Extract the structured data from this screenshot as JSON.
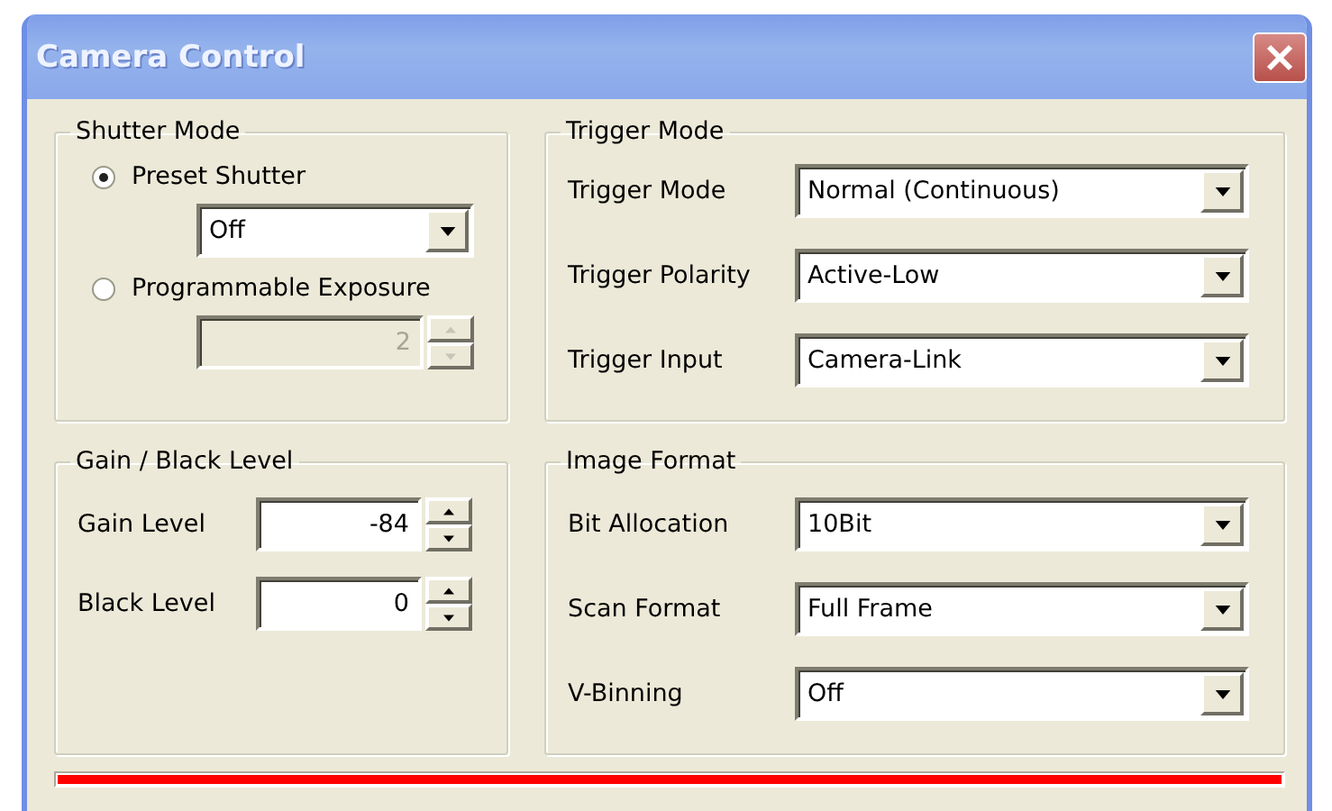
{
  "window": {
    "title": "Camera Control"
  },
  "shutter_mode": {
    "title": "Shutter Mode",
    "options": [
      {
        "label": "Preset Shutter",
        "selected": true,
        "kind": "dropdown",
        "value": "Off",
        "disabled": false
      },
      {
        "label": "Programmable Exposure",
        "selected": false,
        "kind": "spinner",
        "value": "2",
        "disabled": true
      }
    ]
  },
  "trigger_mode": {
    "title": "Trigger Mode",
    "fields": [
      {
        "label": "Trigger Mode",
        "value": "Normal (Continuous)"
      },
      {
        "label": "Trigger Polarity",
        "value": "Active-Low"
      },
      {
        "label": "Trigger Input",
        "value": "Camera-Link"
      }
    ]
  },
  "gain_black_level": {
    "title": "Gain / Black Level",
    "fields": [
      {
        "label": "Gain Level",
        "value": "-84"
      },
      {
        "label": "Black Level",
        "value": "0"
      }
    ]
  },
  "image_format": {
    "title": "Image Format",
    "fields": [
      {
        "label": "Bit Allocation",
        "value": "10Bit"
      },
      {
        "label": "Scan Format",
        "value": "Full Frame"
      },
      {
        "label": "V-Binning",
        "value": "Off"
      }
    ]
  },
  "progress_bar": {
    "level": 1
  }
}
